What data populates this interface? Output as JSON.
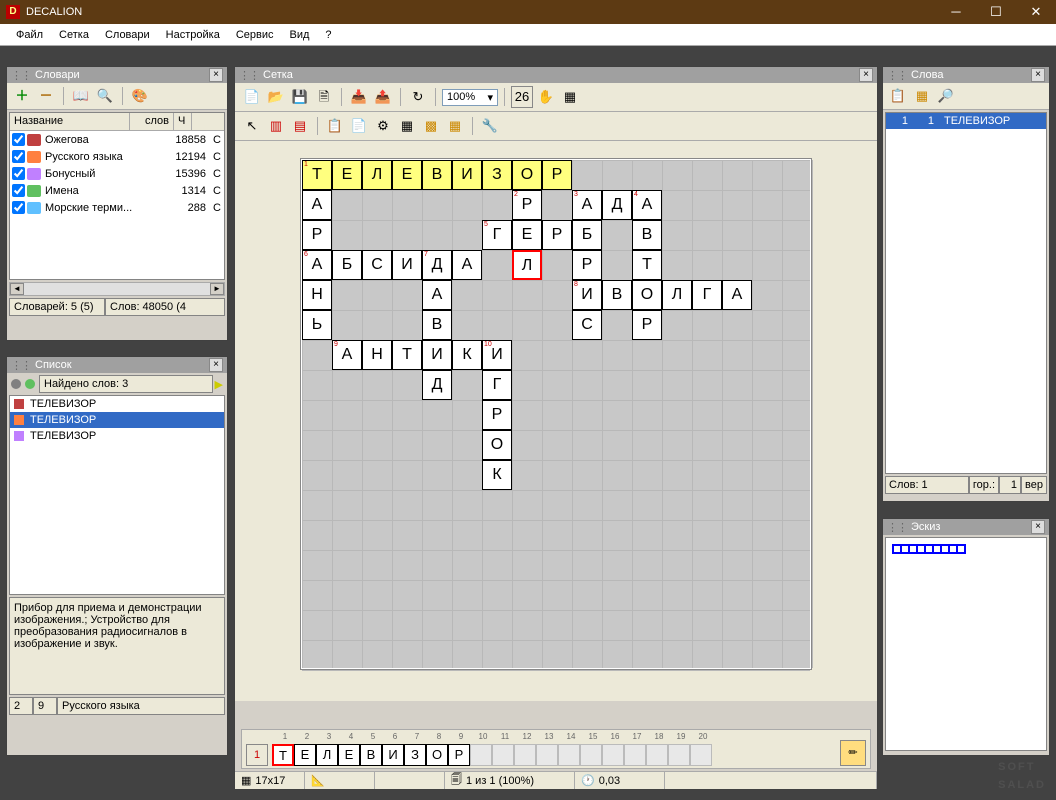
{
  "app": {
    "title": "DECALION",
    "icon_letter": "D"
  },
  "menu": [
    "Файл",
    "Сетка",
    "Словари",
    "Настройка",
    "Сервис",
    "Вид",
    "?"
  ],
  "dictionaries": {
    "title": "Словари",
    "columns": {
      "name": "Название",
      "words": "слов",
      "aux": "Ч"
    },
    "items": [
      {
        "checked": true,
        "color": "#c04040",
        "name": "Ожегова",
        "count": "18858",
        "aux": "С"
      },
      {
        "checked": true,
        "color": "#ff8040",
        "name": "Русского языка",
        "count": "12194",
        "aux": "С"
      },
      {
        "checked": true,
        "color": "#c080ff",
        "name": "Бонусный",
        "count": "15396",
        "aux": "С"
      },
      {
        "checked": true,
        "color": "#60c060",
        "name": "Имена",
        "count": "1314",
        "aux": "С"
      },
      {
        "checked": true,
        "color": "#60c0ff",
        "name": "Морские терми...",
        "count": "288",
        "aux": "С"
      }
    ],
    "status": {
      "dict_count": "Словарей: 5 (5)",
      "word_count": "Слов: 48050 (4"
    }
  },
  "list": {
    "title": "Список",
    "found_label": "Найдено слов: 3",
    "items": [
      {
        "color": "#c04040",
        "text": "ТЕЛЕВИЗОР",
        "selected": false
      },
      {
        "color": "#ff8040",
        "text": "ТЕЛЕВИЗОР",
        "selected": true
      },
      {
        "color": "#c080ff",
        "text": "ТЕЛЕВИЗОР",
        "selected": false
      }
    ],
    "description": "Прибор для приема и демонстрации изображения.; Устройство для преобразования радиосигналов в изображение и звук.",
    "status": {
      "a": "2",
      "b": "9",
      "c": "Русского языка"
    }
  },
  "grid": {
    "title": "Сетка",
    "zoom": "100%",
    "size": "17x17",
    "status_mid": "1 из 1 (100%)",
    "status_time": "0,03",
    "strip": {
      "number": "1",
      "letters": [
        "Т",
        "Е",
        "Л",
        "Е",
        "В",
        "И",
        "З",
        "О",
        "Р"
      ],
      "max_cols": 20
    },
    "cells": [
      {
        "r": 0,
        "c": 0,
        "ch": "Т",
        "n": "1",
        "a": true
      },
      {
        "r": 0,
        "c": 1,
        "ch": "Е",
        "a": true
      },
      {
        "r": 0,
        "c": 2,
        "ch": "Л",
        "a": true
      },
      {
        "r": 0,
        "c": 3,
        "ch": "Е",
        "a": true
      },
      {
        "r": 0,
        "c": 4,
        "ch": "В",
        "a": true
      },
      {
        "r": 0,
        "c": 5,
        "ch": "И",
        "a": true
      },
      {
        "r": 0,
        "c": 6,
        "ch": "З",
        "a": true
      },
      {
        "r": 0,
        "c": 7,
        "ch": "О",
        "a": true
      },
      {
        "r": 0,
        "c": 8,
        "ch": "Р",
        "a": true
      },
      {
        "r": 1,
        "c": 0,
        "ch": "А"
      },
      {
        "r": 1,
        "c": 7,
        "ch": "Р",
        "n": "2"
      },
      {
        "r": 1,
        "c": 9,
        "ch": "А",
        "n": "3"
      },
      {
        "r": 1,
        "c": 10,
        "ch": "Д"
      },
      {
        "r": 1,
        "c": 11,
        "ch": "А",
        "n": "4"
      },
      {
        "r": 2,
        "c": 0,
        "ch": "Р"
      },
      {
        "r": 2,
        "c": 6,
        "ch": "Г",
        "n": "5"
      },
      {
        "r": 2,
        "c": 7,
        "ch": "Е"
      },
      {
        "r": 2,
        "c": 8,
        "ch": "Р"
      },
      {
        "r": 2,
        "c": 9,
        "ch": "Б"
      },
      {
        "r": 2,
        "c": 11,
        "ch": "В"
      },
      {
        "r": 3,
        "c": 0,
        "ch": "А",
        "n": "6"
      },
      {
        "r": 3,
        "c": 1,
        "ch": "Б"
      },
      {
        "r": 3,
        "c": 2,
        "ch": "С"
      },
      {
        "r": 3,
        "c": 3,
        "ch": "И"
      },
      {
        "r": 3,
        "c": 4,
        "ch": "Д",
        "n": "7"
      },
      {
        "r": 3,
        "c": 5,
        "ch": "А"
      },
      {
        "r": 3,
        "c": 7,
        "ch": "Л",
        "hl": true
      },
      {
        "r": 3,
        "c": 9,
        "ch": "Р"
      },
      {
        "r": 3,
        "c": 11,
        "ch": "Т"
      },
      {
        "r": 4,
        "c": 0,
        "ch": "Н"
      },
      {
        "r": 4,
        "c": 4,
        "ch": "А"
      },
      {
        "r": 4,
        "c": 9,
        "ch": "И",
        "n": "8"
      },
      {
        "r": 4,
        "c": 10,
        "ch": "В"
      },
      {
        "r": 4,
        "c": 11,
        "ch": "О"
      },
      {
        "r": 4,
        "c": 12,
        "ch": "Л"
      },
      {
        "r": 4,
        "c": 13,
        "ch": "Г"
      },
      {
        "r": 4,
        "c": 14,
        "ch": "А"
      },
      {
        "r": 5,
        "c": 0,
        "ch": "Ь"
      },
      {
        "r": 5,
        "c": 4,
        "ch": "В"
      },
      {
        "r": 5,
        "c": 9,
        "ch": "С"
      },
      {
        "r": 5,
        "c": 11,
        "ch": "Р"
      },
      {
        "r": 6,
        "c": 1,
        "ch": "А",
        "n": "9"
      },
      {
        "r": 6,
        "c": 2,
        "ch": "Н"
      },
      {
        "r": 6,
        "c": 3,
        "ch": "Т"
      },
      {
        "r": 6,
        "c": 4,
        "ch": "И"
      },
      {
        "r": 6,
        "c": 5,
        "ch": "К"
      },
      {
        "r": 6,
        "c": 6,
        "ch": "И",
        "n": "10"
      },
      {
        "r": 7,
        "c": 4,
        "ch": "Д"
      },
      {
        "r": 7,
        "c": 6,
        "ch": "Г"
      },
      {
        "r": 8,
        "c": 6,
        "ch": "Р"
      },
      {
        "r": 9,
        "c": 6,
        "ch": "О"
      },
      {
        "r": 10,
        "c": 6,
        "ch": "К"
      }
    ]
  },
  "words": {
    "title": "Слова",
    "items": [
      {
        "n": "1",
        "g": "1",
        "text": "ТЕЛЕВИЗОР",
        "selected": true
      }
    ],
    "status": {
      "count": "Слов: 1",
      "hor_lbl": "гор.:",
      "hor_val": "1",
      "ver": "вер"
    }
  },
  "thumb": {
    "title": "Эскиз",
    "cells": 9
  },
  "watermark": {
    "l1": "SOFT",
    "l2": "SALAD"
  }
}
